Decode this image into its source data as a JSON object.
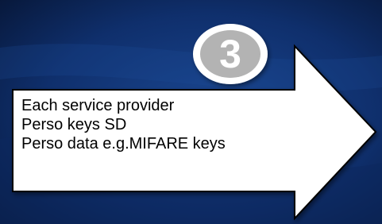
{
  "colors": {
    "background_dark": "#071636",
    "background_mid": "#123a7c",
    "arrow_fill": "#ffffff",
    "arrow_stroke": "#000000",
    "badge_fill": "#b3b3b3",
    "badge_ring": "#ffffff",
    "text": "#000000"
  },
  "step": {
    "number": "3",
    "badge_icon": "number-badge-icon",
    "arrow_icon": "right-arrow-icon",
    "lines": [
      "Each service provider",
      "Perso keys SD",
      "Perso data e.g.MIFARE keys"
    ]
  }
}
